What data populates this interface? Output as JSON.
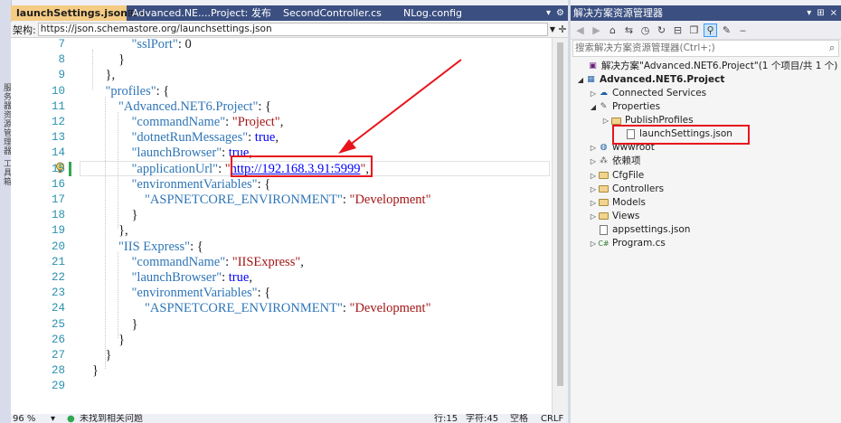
{
  "side_strip": {
    "text": "服务器资源管理器  工具箱"
  },
  "tabs": [
    {
      "label": "launchSettings.json",
      "active": true,
      "pin": "⊞",
      "close": "×"
    },
    {
      "label": "Advanced.NE....Project: 发布"
    },
    {
      "label": "SecondController.cs"
    },
    {
      "label": "NLog.config"
    }
  ],
  "tab_controls": [
    "▾",
    "⚙"
  ],
  "schema": {
    "label": "架构:",
    "url": "https://json.schemastore.org/launchsettings.json"
  },
  "editor": {
    "lines": [
      {
        "n": "7",
        "text": "\"sslPort\": 0"
      },
      {
        "n": "8",
        "text": "}"
      },
      {
        "n": "9",
        "text": "},"
      },
      {
        "n": "10",
        "text": "\"profiles\": {"
      },
      {
        "n": "11",
        "text": "\"Advanced.NET6.Project\": {"
      },
      {
        "n": "12",
        "text": "\"commandName\": \"Project\","
      },
      {
        "n": "13",
        "text": "\"dotnetRunMessages\": true,"
      },
      {
        "n": "14",
        "text": "\"launchBrowser\": true,"
      },
      {
        "n": "15",
        "text": "\"applicationUrl\": \"http://192.168.3.91:5999\","
      },
      {
        "n": "16",
        "text": "\"environmentVariables\": {"
      },
      {
        "n": "17",
        "text": "\"ASPNETCORE_ENVIRONMENT\": \"Development\""
      },
      {
        "n": "18",
        "text": "}"
      },
      {
        "n": "19",
        "text": "},"
      },
      {
        "n": "20",
        "text": "\"IIS Express\": {"
      },
      {
        "n": "21",
        "text": "\"commandName\": \"IISExpress\","
      },
      {
        "n": "22",
        "text": "\"launchBrowser\": true,"
      },
      {
        "n": "23",
        "text": "\"environmentVariables\": {"
      },
      {
        "n": "24",
        "text": "\"ASPNETCORE_ENVIRONMENT\": \"Development\""
      },
      {
        "n": "25",
        "text": "}"
      },
      {
        "n": "26",
        "text": "}"
      },
      {
        "n": "27",
        "text": "}"
      },
      {
        "n": "28",
        "text": "}"
      },
      {
        "n": "29",
        "text": ""
      }
    ],
    "current_line": "15"
  },
  "status": {
    "zoom": "96 %",
    "issues": "未找到相关问题",
    "line": "行:15",
    "char": "字符:45",
    "mode": "空格",
    "eol": "CRLF"
  },
  "solution_explorer": {
    "title": "解决方案资源管理器",
    "title_controls": [
      "▾",
      "⊞",
      "×"
    ],
    "search_placeholder": "搜索解决方案资源管理器(Ctrl+;)",
    "search_icon": "⌕",
    "tree": [
      {
        "label": "解决方案\"Advanced.NET6.Project\"(1 个项目/共 1 个)",
        "icon": "solution-icon"
      },
      {
        "label": "Advanced.NET6.Project",
        "icon": "project-icon"
      },
      {
        "label": "Connected Services",
        "icon": "connected-services-icon"
      },
      {
        "label": "Properties",
        "icon": "wrench-icon"
      },
      {
        "label": "PublishProfiles",
        "icon": "folder-icon"
      },
      {
        "label": "launchSettings.json",
        "icon": "json-file-icon"
      },
      {
        "label": "wwwroot",
        "icon": "globe-icon"
      },
      {
        "label": "依赖项",
        "icon": "dependencies-icon"
      },
      {
        "label": "CfgFile",
        "icon": "folder-icon"
      },
      {
        "label": "Controllers",
        "icon": "folder-icon"
      },
      {
        "label": "Models",
        "icon": "folder-icon"
      },
      {
        "label": "Views",
        "icon": "folder-icon"
      },
      {
        "label": "appsettings.json",
        "icon": "json-file-icon"
      },
      {
        "label": "Program.cs",
        "icon": "csharp-file-icon"
      }
    ]
  },
  "colors": {
    "accent": "#3b4f81",
    "active_tab": "#f5cc84",
    "annotation": "#e8141c",
    "line_numbers": "#2b91af",
    "json_key": "#2e75b6",
    "json_string": "#a31515",
    "keyword": "#0000ff"
  }
}
